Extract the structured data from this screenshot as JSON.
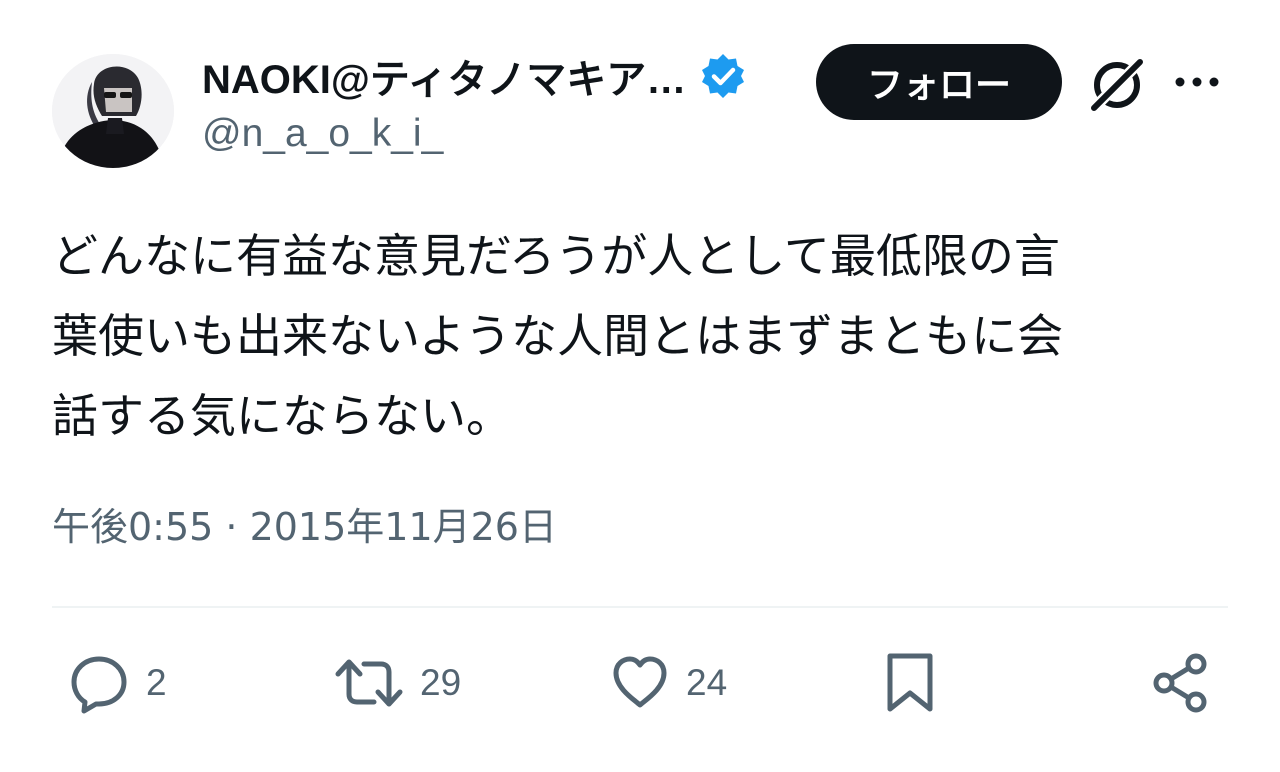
{
  "user": {
    "display_name": "NAOKI@ティタノマキア…",
    "handle": "@n_a_o_k_i_",
    "verified": true,
    "verified_color": "#1d9bf0"
  },
  "header": {
    "follow_label": "フォロー",
    "grok_icon": "grok-icon",
    "more_icon": "more-icon"
  },
  "tweet": {
    "lines": [
      "どんなに有益な意見だろうが人として最低限の言",
      "葉使いも出来ないような人間とはまずまともに会",
      "話する気にならない。"
    ],
    "timestamp": "午後0:55 · 2015年11月26日"
  },
  "actions": {
    "reply_count": "2",
    "retweet_count": "29",
    "like_count": "24"
  },
  "colors": {
    "text": "#0f1419",
    "secondary": "#536471",
    "button_bg": "#0f1419",
    "divider": "#eff3f4"
  }
}
